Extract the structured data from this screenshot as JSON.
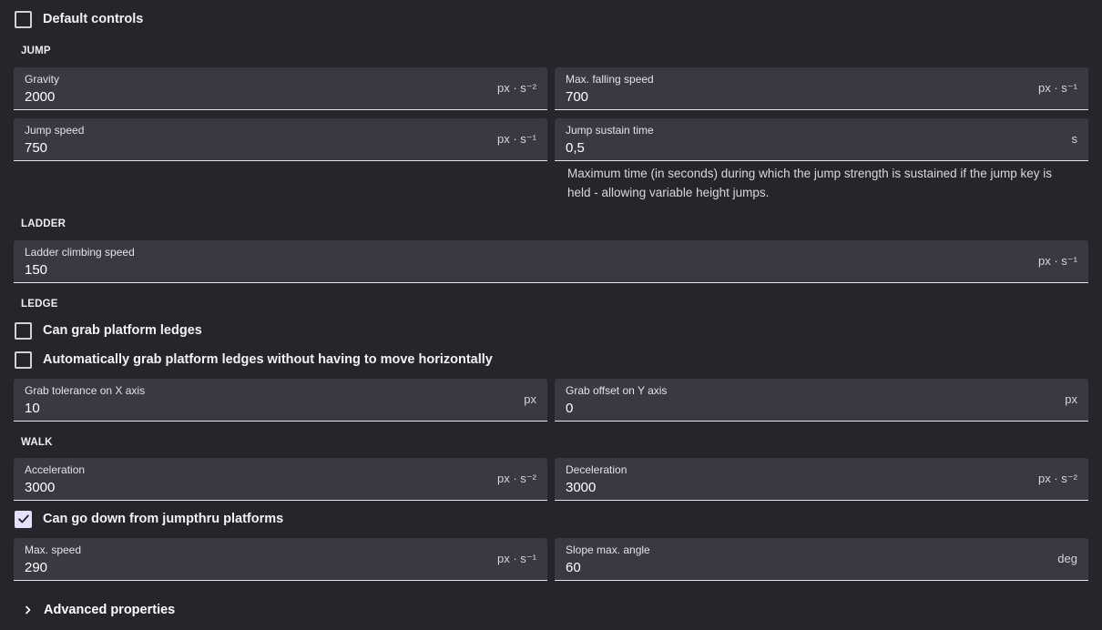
{
  "default_controls": {
    "label": "Default controls",
    "checked": false
  },
  "sections": {
    "jump": "JUMP",
    "ladder": "LADDER",
    "ledge": "LEDGE",
    "walk": "WALK"
  },
  "fields": {
    "gravity": {
      "label": "Gravity",
      "value": "2000",
      "unit": "px · s⁻²"
    },
    "max_falling_speed": {
      "label": "Max. falling speed",
      "value": "700",
      "unit": "px · s⁻¹"
    },
    "jump_speed": {
      "label": "Jump speed",
      "value": "750",
      "unit": "px · s⁻¹"
    },
    "jump_sustain_time": {
      "label": "Jump sustain time",
      "value": "0,5",
      "unit": "s"
    },
    "ladder_climbing_speed": {
      "label": "Ladder climbing speed",
      "value": "150",
      "unit": "px · s⁻¹"
    },
    "grab_tolerance_x": {
      "label": "Grab tolerance on X axis",
      "value": "10",
      "unit": "px"
    },
    "grab_offset_y": {
      "label": "Grab offset on Y axis",
      "value": "0",
      "unit": "px"
    },
    "acceleration": {
      "label": "Acceleration",
      "value": "3000",
      "unit": "px · s⁻²"
    },
    "deceleration": {
      "label": "Deceleration",
      "value": "3000",
      "unit": "px · s⁻²"
    },
    "max_speed": {
      "label": "Max. speed",
      "value": "290",
      "unit": "px · s⁻¹"
    },
    "slope_max_angle": {
      "label": "Slope max. angle",
      "value": "60",
      "unit": "deg"
    }
  },
  "jump_sustain_help": "Maximum time (in seconds) during which the jump strength is sustained if the jump key is held - allowing variable height jumps.",
  "checkboxes": {
    "can_grab_ledges": {
      "label": "Can grab platform ledges",
      "checked": false
    },
    "auto_grab_ledges": {
      "label": "Automatically grab platform ledges without having to move horizontally",
      "checked": false
    },
    "can_go_down_jumpthru": {
      "label": "Can go down from jumpthru platforms",
      "checked": true
    }
  },
  "advanced": {
    "label": "Advanced properties",
    "icon": "chevron-right-icon"
  }
}
